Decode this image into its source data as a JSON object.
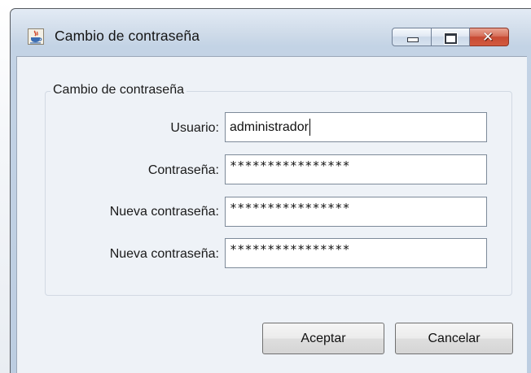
{
  "window": {
    "title": "Cambio de contraseña",
    "app_icon": "java-cup-icon",
    "caption_buttons": {
      "minimize_icon": "minimize-icon",
      "maximize_icon": "maximize-icon",
      "close_icon": "close-icon",
      "close_glyph": "✕",
      "close_color": "#c74a33"
    }
  },
  "form": {
    "group_title": "Cambio de contraseña",
    "fields": [
      {
        "label": "Usuario:",
        "value": "administrador",
        "type": "text"
      },
      {
        "label": "Contraseña:",
        "value": "****************",
        "type": "password"
      },
      {
        "label": "Nueva contraseña:",
        "value": "****************",
        "type": "password"
      },
      {
        "label": "Nueva contraseña:",
        "value": "****************",
        "type": "password"
      }
    ]
  },
  "buttons": {
    "accept": "Aceptar",
    "cancel": "Cancelar"
  }
}
